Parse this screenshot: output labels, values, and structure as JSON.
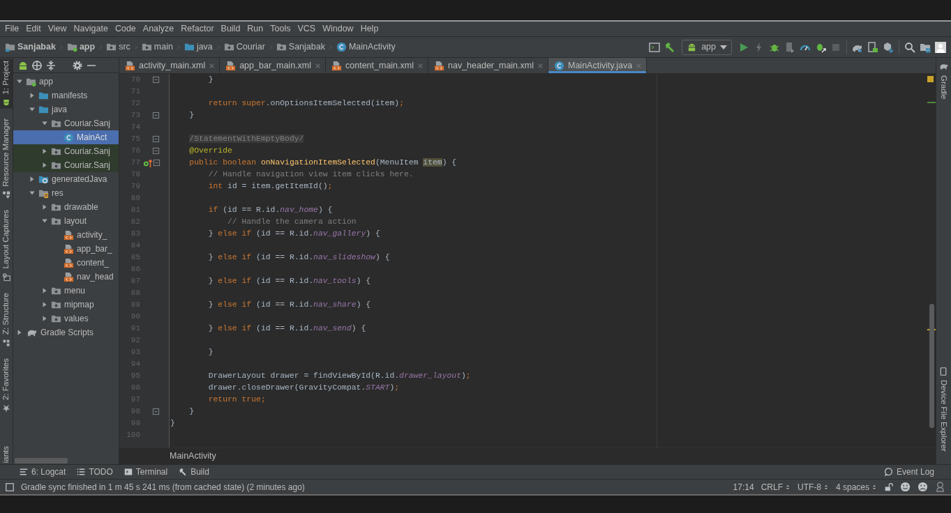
{
  "menu": [
    "File",
    "Edit",
    "View",
    "Navigate",
    "Code",
    "Analyze",
    "Refactor",
    "Build",
    "Run",
    "Tools",
    "VCS",
    "Window",
    "Help"
  ],
  "breadcrumb": [
    {
      "label": "Sanjabak",
      "kind": "project"
    },
    {
      "label": "app",
      "kind": "module"
    },
    {
      "label": "src",
      "kind": "folder"
    },
    {
      "label": "main",
      "kind": "folder"
    },
    {
      "label": "java",
      "kind": "source"
    },
    {
      "label": "Couriar",
      "kind": "package"
    },
    {
      "label": "Sanjabak",
      "kind": "package"
    },
    {
      "label": "MainActivity",
      "kind": "class"
    }
  ],
  "run_config": {
    "label": "app"
  },
  "left_tool_tabs": [
    {
      "label": "1: Project",
      "kind": "project",
      "selected": true
    },
    {
      "label": "Resource Manager",
      "kind": "resources",
      "selected": false
    },
    {
      "label": "Layout Captures",
      "kind": "captures",
      "selected": false
    },
    {
      "label": "Z: Structure",
      "kind": "structure",
      "selected": false
    },
    {
      "label": "2: Favorites",
      "kind": "favorites",
      "selected": false
    },
    {
      "label": "iants",
      "kind": "variants",
      "selected": false
    }
  ],
  "right_tool_tabs": [
    {
      "label": "Gradle",
      "kind": "gradle"
    },
    {
      "label": "Device File Explorer",
      "kind": "device"
    }
  ],
  "project_tree": [
    {
      "label": "app",
      "kind": "module",
      "expanded": true,
      "selected": false,
      "children": [
        {
          "label": "manifests",
          "kind": "source-folder",
          "expanded": false,
          "selected": false
        },
        {
          "label": "java",
          "kind": "source-folder",
          "expanded": true,
          "selected": false,
          "children": [
            {
              "label": "Couriar.Sanj",
              "kind": "package",
              "expanded": true,
              "selected": false,
              "children": [
                {
                  "label": "MainAct",
                  "kind": "class",
                  "selected": true
                }
              ]
            },
            {
              "label": "Couriar.Sanj",
              "kind": "test-package",
              "expanded": false,
              "selected": false
            },
            {
              "label": "Couriar.Sanj",
              "kind": "test-package",
              "expanded": false,
              "selected": false
            }
          ]
        },
        {
          "label": "generatedJava",
          "kind": "generated-folder",
          "expanded": false,
          "selected": false
        },
        {
          "label": "res",
          "kind": "res-folder",
          "expanded": true,
          "selected": false,
          "children": [
            {
              "label": "drawable",
              "kind": "folder",
              "expanded": false,
              "selected": false
            },
            {
              "label": "layout",
              "kind": "folder",
              "expanded": true,
              "selected": false,
              "children": [
                {
                  "label": "activity_",
                  "kind": "layout-file",
                  "selected": false
                },
                {
                  "label": "app_bar_",
                  "kind": "layout-file",
                  "selected": false
                },
                {
                  "label": "content_",
                  "kind": "layout-file",
                  "selected": false
                },
                {
                  "label": "nav_head",
                  "kind": "layout-file",
                  "selected": false
                }
              ]
            },
            {
              "label": "menu",
              "kind": "folder",
              "expanded": false,
              "selected": false
            },
            {
              "label": "mipmap",
              "kind": "folder",
              "expanded": false,
              "selected": false
            },
            {
              "label": "values",
              "kind": "folder",
              "expanded": false,
              "selected": false
            }
          ]
        }
      ]
    },
    {
      "label": "Gradle Scripts",
      "kind": "gradle",
      "expanded": false,
      "selected": false
    }
  ],
  "tabs": [
    {
      "label": "activity_main.xml",
      "kind": "xml",
      "selected": false
    },
    {
      "label": "app_bar_main.xml",
      "kind": "xml",
      "selected": false
    },
    {
      "label": "content_main.xml",
      "kind": "xml",
      "selected": false
    },
    {
      "label": "nav_header_main.xml",
      "kind": "xml",
      "selected": false
    },
    {
      "label": "MainActivity.java",
      "kind": "class",
      "selected": true
    }
  ],
  "editor": {
    "lines": [
      {
        "number": "70",
        "fold": true,
        "tokens": [
          {
            "kind": "plain",
            "text": "        }"
          }
        ]
      },
      {
        "number": "71"
      },
      {
        "number": "72",
        "tokens": [
          {
            "kind": "keyword",
            "text": "        return super"
          },
          {
            "kind": "plain",
            "text": ".onOptionsItemSelected(item)"
          },
          {
            "kind": "keyword",
            "text": ";"
          }
        ]
      },
      {
        "number": "73",
        "fold": true,
        "tokens": [
          {
            "kind": "plain",
            "text": "    }"
          }
        ]
      },
      {
        "number": "74"
      },
      {
        "number": "75",
        "fold": true,
        "tokens": [
          {
            "kind": "suppressed",
            "text": "    /StatementWithEmptyBody/"
          }
        ]
      },
      {
        "number": "76",
        "fold": true,
        "tokens": [
          {
            "kind": "annotation",
            "text": "    @Override"
          }
        ]
      },
      {
        "number": "77",
        "fold": true,
        "override_marker": true,
        "tokens": [
          {
            "kind": "keyword",
            "text": "    public boolean "
          },
          {
            "kind": "declaration",
            "text": "onNavigationItemSelected"
          },
          {
            "kind": "plain",
            "text": "(MenuItem "
          },
          {
            "kind": "highlight",
            "text": "item"
          },
          {
            "kind": "plain",
            "text": ") {"
          }
        ]
      },
      {
        "number": "78",
        "tokens": [
          {
            "kind": "comment",
            "text": "        // Handle navigation view item clicks here."
          }
        ]
      },
      {
        "number": "79",
        "tokens": [
          {
            "kind": "keyword",
            "text": "        int"
          },
          {
            "kind": "plain",
            "text": " id = item.getItemId()"
          },
          {
            "kind": "keyword",
            "text": ";"
          }
        ]
      },
      {
        "number": "80"
      },
      {
        "number": "81",
        "tokens": [
          {
            "kind": "keyword",
            "text": "        if"
          },
          {
            "kind": "plain",
            "text": " (id == R.id."
          },
          {
            "kind": "field",
            "text": "nav_home"
          },
          {
            "kind": "plain",
            "text": ") {"
          }
        ]
      },
      {
        "number": "82",
        "tokens": [
          {
            "kind": "comment",
            "text": "            // Handle the camera action"
          }
        ]
      },
      {
        "number": "83",
        "tokens": [
          {
            "kind": "plain",
            "text": "        } "
          },
          {
            "kind": "keyword",
            "text": "else if"
          },
          {
            "kind": "plain",
            "text": " (id == R.id."
          },
          {
            "kind": "field",
            "text": "nav_gallery"
          },
          {
            "kind": "plain",
            "text": ") {"
          }
        ]
      },
      {
        "number": "84"
      },
      {
        "number": "85",
        "tokens": [
          {
            "kind": "plain",
            "text": "        } "
          },
          {
            "kind": "keyword",
            "text": "else if"
          },
          {
            "kind": "plain",
            "text": " (id == R.id."
          },
          {
            "kind": "field",
            "text": "nav_slideshow"
          },
          {
            "kind": "plain",
            "text": ") {"
          }
        ]
      },
      {
        "number": "86"
      },
      {
        "number": "87",
        "tokens": [
          {
            "kind": "plain",
            "text": "        } "
          },
          {
            "kind": "keyword",
            "text": "else if"
          },
          {
            "kind": "plain",
            "text": " (id == R.id."
          },
          {
            "kind": "field",
            "text": "nav_tools"
          },
          {
            "kind": "plain",
            "text": ") {"
          }
        ]
      },
      {
        "number": "88"
      },
      {
        "number": "89",
        "tokens": [
          {
            "kind": "plain",
            "text": "        } "
          },
          {
            "kind": "keyword",
            "text": "else if"
          },
          {
            "kind": "plain",
            "text": " (id == R.id."
          },
          {
            "kind": "field",
            "text": "nav_share"
          },
          {
            "kind": "plain",
            "text": ") {"
          }
        ]
      },
      {
        "number": "90"
      },
      {
        "number": "91",
        "tokens": [
          {
            "kind": "plain",
            "text": "        } "
          },
          {
            "kind": "keyword",
            "text": "else if"
          },
          {
            "kind": "plain",
            "text": " (id == R.id."
          },
          {
            "kind": "field",
            "text": "nav_send"
          },
          {
            "kind": "plain",
            "text": ") {"
          }
        ]
      },
      {
        "number": "92"
      },
      {
        "number": "93",
        "tokens": [
          {
            "kind": "plain",
            "text": "        }"
          }
        ]
      },
      {
        "number": "94"
      },
      {
        "number": "95",
        "tokens": [
          {
            "kind": "plain",
            "text": "        DrawerLayout drawer = findViewById(R.id."
          },
          {
            "kind": "field",
            "text": "drawer_layout"
          },
          {
            "kind": "plain",
            "text": ")"
          },
          {
            "kind": "keyword",
            "text": ";"
          }
        ]
      },
      {
        "number": "96",
        "tokens": [
          {
            "kind": "plain",
            "text": "        drawer.closeDrawer(GravityCompat."
          },
          {
            "kind": "field",
            "text": "START"
          },
          {
            "kind": "plain",
            "text": ")"
          },
          {
            "kind": "keyword",
            "text": ";"
          }
        ]
      },
      {
        "number": "97",
        "tokens": [
          {
            "kind": "keyword",
            "text": "        return true;"
          }
        ]
      },
      {
        "number": "98",
        "fold": true,
        "tokens": [
          {
            "kind": "plain",
            "text": "    }"
          }
        ]
      },
      {
        "number": "99",
        "tokens": [
          {
            "kind": "plain",
            "text": "}"
          }
        ]
      },
      {
        "number": "100"
      }
    ],
    "footer_breadcrumb": "MainActivity"
  },
  "tool_windows": [
    {
      "label": "6: Logcat",
      "kind": "logcat"
    },
    {
      "label": "TODO",
      "kind": "todo"
    },
    {
      "label": "Terminal",
      "kind": "terminal"
    },
    {
      "label": "Build",
      "kind": "build"
    }
  ],
  "event_log": "Event Log",
  "status": {
    "message": "Gradle sync finished in 1 m 45 s 241 ms (from cached state) (2 minutes ago)",
    "position": "17:14",
    "line_separator": "CRLF",
    "encoding": "UTF-8",
    "indent": "4 spaces"
  }
}
